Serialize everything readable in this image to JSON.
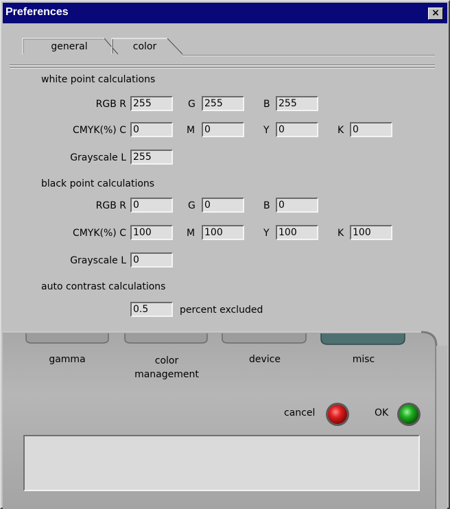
{
  "window": {
    "title": "Preferences",
    "close_glyph": "×"
  },
  "top_tabs": [
    {
      "label": "general"
    },
    {
      "label": "color"
    }
  ],
  "white_point": {
    "heading": "white point calculations",
    "rgb": {
      "label": "RGB R",
      "r": "255",
      "g_label": "G",
      "g": "255",
      "b_label": "B",
      "b": "255"
    },
    "cmyk": {
      "label": "CMYK(%) C",
      "c": "0",
      "m_label": "M",
      "m": "0",
      "y_label": "Y",
      "y": "0",
      "k_label": "K",
      "k": "0"
    },
    "gray": {
      "label": "Grayscale L",
      "l": "255"
    }
  },
  "black_point": {
    "heading": "black point calculations",
    "rgb": {
      "label": "RGB R",
      "r": "0",
      "g_label": "G",
      "g": "0",
      "b_label": "B",
      "b": "0"
    },
    "cmyk": {
      "label": "CMYK(%) C",
      "c": "100",
      "m_label": "M",
      "m": "100",
      "y_label": "Y",
      "y": "100",
      "k_label": "K",
      "k": "100"
    },
    "gray": {
      "label": "Grayscale L",
      "l": "0"
    }
  },
  "auto_contrast": {
    "heading": "auto contrast calculations",
    "value": "0.5",
    "suffix": "percent excluded"
  },
  "bottom_tabs": [
    {
      "label": "gamma"
    },
    {
      "label": "color\nmanagement"
    },
    {
      "label": "device"
    },
    {
      "label": "misc"
    }
  ],
  "actions": {
    "cancel_label": "cancel",
    "cancel_color": "#d81818",
    "ok_label": "OK",
    "ok_color": "#1ea21e"
  },
  "colors": {
    "titlebar": "#080878",
    "active_bottom_tab": "#4e7070",
    "panel": "#c0c0c0"
  }
}
